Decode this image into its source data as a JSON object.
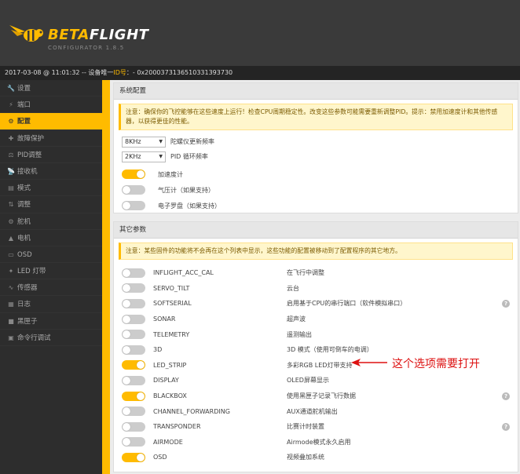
{
  "app": {
    "title_strong": "BETA",
    "title_light": "FLIGHT",
    "subtitle": "CONFIGURATOR 1.8.5"
  },
  "statusbar": {
    "timestamp": "2017-03-08 @ 11:01:32",
    "device_label": " -- 设备唯一",
    "id_label": "ID号",
    "id_value": "：- 0x200037313651033139373​0"
  },
  "sidebar": {
    "items": [
      {
        "label": "设置",
        "icon": "wrench-icon",
        "glyph": "🔧"
      },
      {
        "label": "端口",
        "icon": "plug-icon",
        "glyph": "⚡"
      },
      {
        "label": "配置",
        "icon": "gear-icon",
        "glyph": "⚙"
      },
      {
        "label": "故障保护",
        "icon": "failsafe-icon",
        "glyph": "✚"
      },
      {
        "label": "PID调整",
        "icon": "pid-icon",
        "glyph": "⚖"
      },
      {
        "label": "接收机",
        "icon": "receiver-icon",
        "glyph": "📡"
      },
      {
        "label": "模式",
        "icon": "modes-icon",
        "glyph": "▤"
      },
      {
        "label": "调整",
        "icon": "adjustments-icon",
        "glyph": "⇅"
      },
      {
        "label": "舵机",
        "icon": "servo-icon",
        "glyph": "⚙"
      },
      {
        "label": "电机",
        "icon": "motor-icon",
        "glyph": "▲"
      },
      {
        "label": "OSD",
        "icon": "osd-icon",
        "glyph": "▭"
      },
      {
        "label": "LED 灯带",
        "icon": "led-icon",
        "glyph": "✦"
      },
      {
        "label": "传感器",
        "icon": "sensor-icon",
        "glyph": "∿"
      },
      {
        "label": "日志",
        "icon": "log-icon",
        "glyph": "▦"
      },
      {
        "label": "黑匣子",
        "icon": "blackbox-icon",
        "glyph": "■"
      },
      {
        "label": "命令行调试",
        "icon": "cli-icon",
        "glyph": "▣"
      }
    ],
    "active_index": 2
  },
  "system_config": {
    "title": "系统配置",
    "note": "注意：确保你的飞控能够在这些速度上运行！检查CPU周期稳定性。改变这些参数可能需要重新调整PID。提示：禁用加速度计和其他传感器，以获得更佳的性能。",
    "gyro_freq": {
      "value": "8KHz",
      "label": "陀螺仪更新频率"
    },
    "pid_freq": {
      "value": "2KHz",
      "label": "PID 循环频率"
    },
    "sensors": [
      {
        "label": "加速度计",
        "on": true
      },
      {
        "label": "气压计（如果支持）",
        "on": false
      },
      {
        "label": "电子罗盘（如果支持）",
        "on": false
      }
    ]
  },
  "other_features": {
    "title": "其它参数",
    "note": "注意：某些固件的功能将不会再在这个列表中显示，这些功能的配置被移动到了配置程序的其它地方。",
    "features": [
      {
        "name": "INFLIGHT_ACC_CAL",
        "desc": "在飞行中调整",
        "on": false,
        "help": false
      },
      {
        "name": "SERVO_TILT",
        "desc": "云台",
        "on": false,
        "help": false
      },
      {
        "name": "SOFTSERIAL",
        "desc": "启用基于CPU的串行端口（软件模拟串口）",
        "on": false,
        "help": true
      },
      {
        "name": "SONAR",
        "desc": "超声波",
        "on": false,
        "help": false
      },
      {
        "name": "TELEMETRY",
        "desc": "遥测输出",
        "on": false,
        "help": false
      },
      {
        "name": "3D",
        "desc": "3D 模式（使用可倒车的电调）",
        "on": false,
        "help": false
      },
      {
        "name": "LED_STRIP",
        "desc": "多彩RGB LED灯带支持",
        "on": true,
        "help": false
      },
      {
        "name": "DISPLAY",
        "desc": "OLED屏幕显示",
        "on": false,
        "help": false
      },
      {
        "name": "BLACKBOX",
        "desc": "使用黑匣子记录飞行数据",
        "on": true,
        "help": true
      },
      {
        "name": "CHANNEL_FORWARDING",
        "desc": "AUX通道舵机输出",
        "on": false,
        "help": false
      },
      {
        "name": "TRANSPONDER",
        "desc": "比赛计时装置",
        "on": false,
        "help": true
      },
      {
        "name": "AIRMODE",
        "desc": "Airmode模式永久启用",
        "on": false,
        "help": false
      },
      {
        "name": "OSD",
        "desc": "视频叠加系统",
        "on": true,
        "help": false
      }
    ],
    "help_glyph": "?"
  },
  "annotation": {
    "text": "这个选项需要打开"
  },
  "colors": {
    "accent": "#ffbb00",
    "annotation": "#d11111"
  }
}
